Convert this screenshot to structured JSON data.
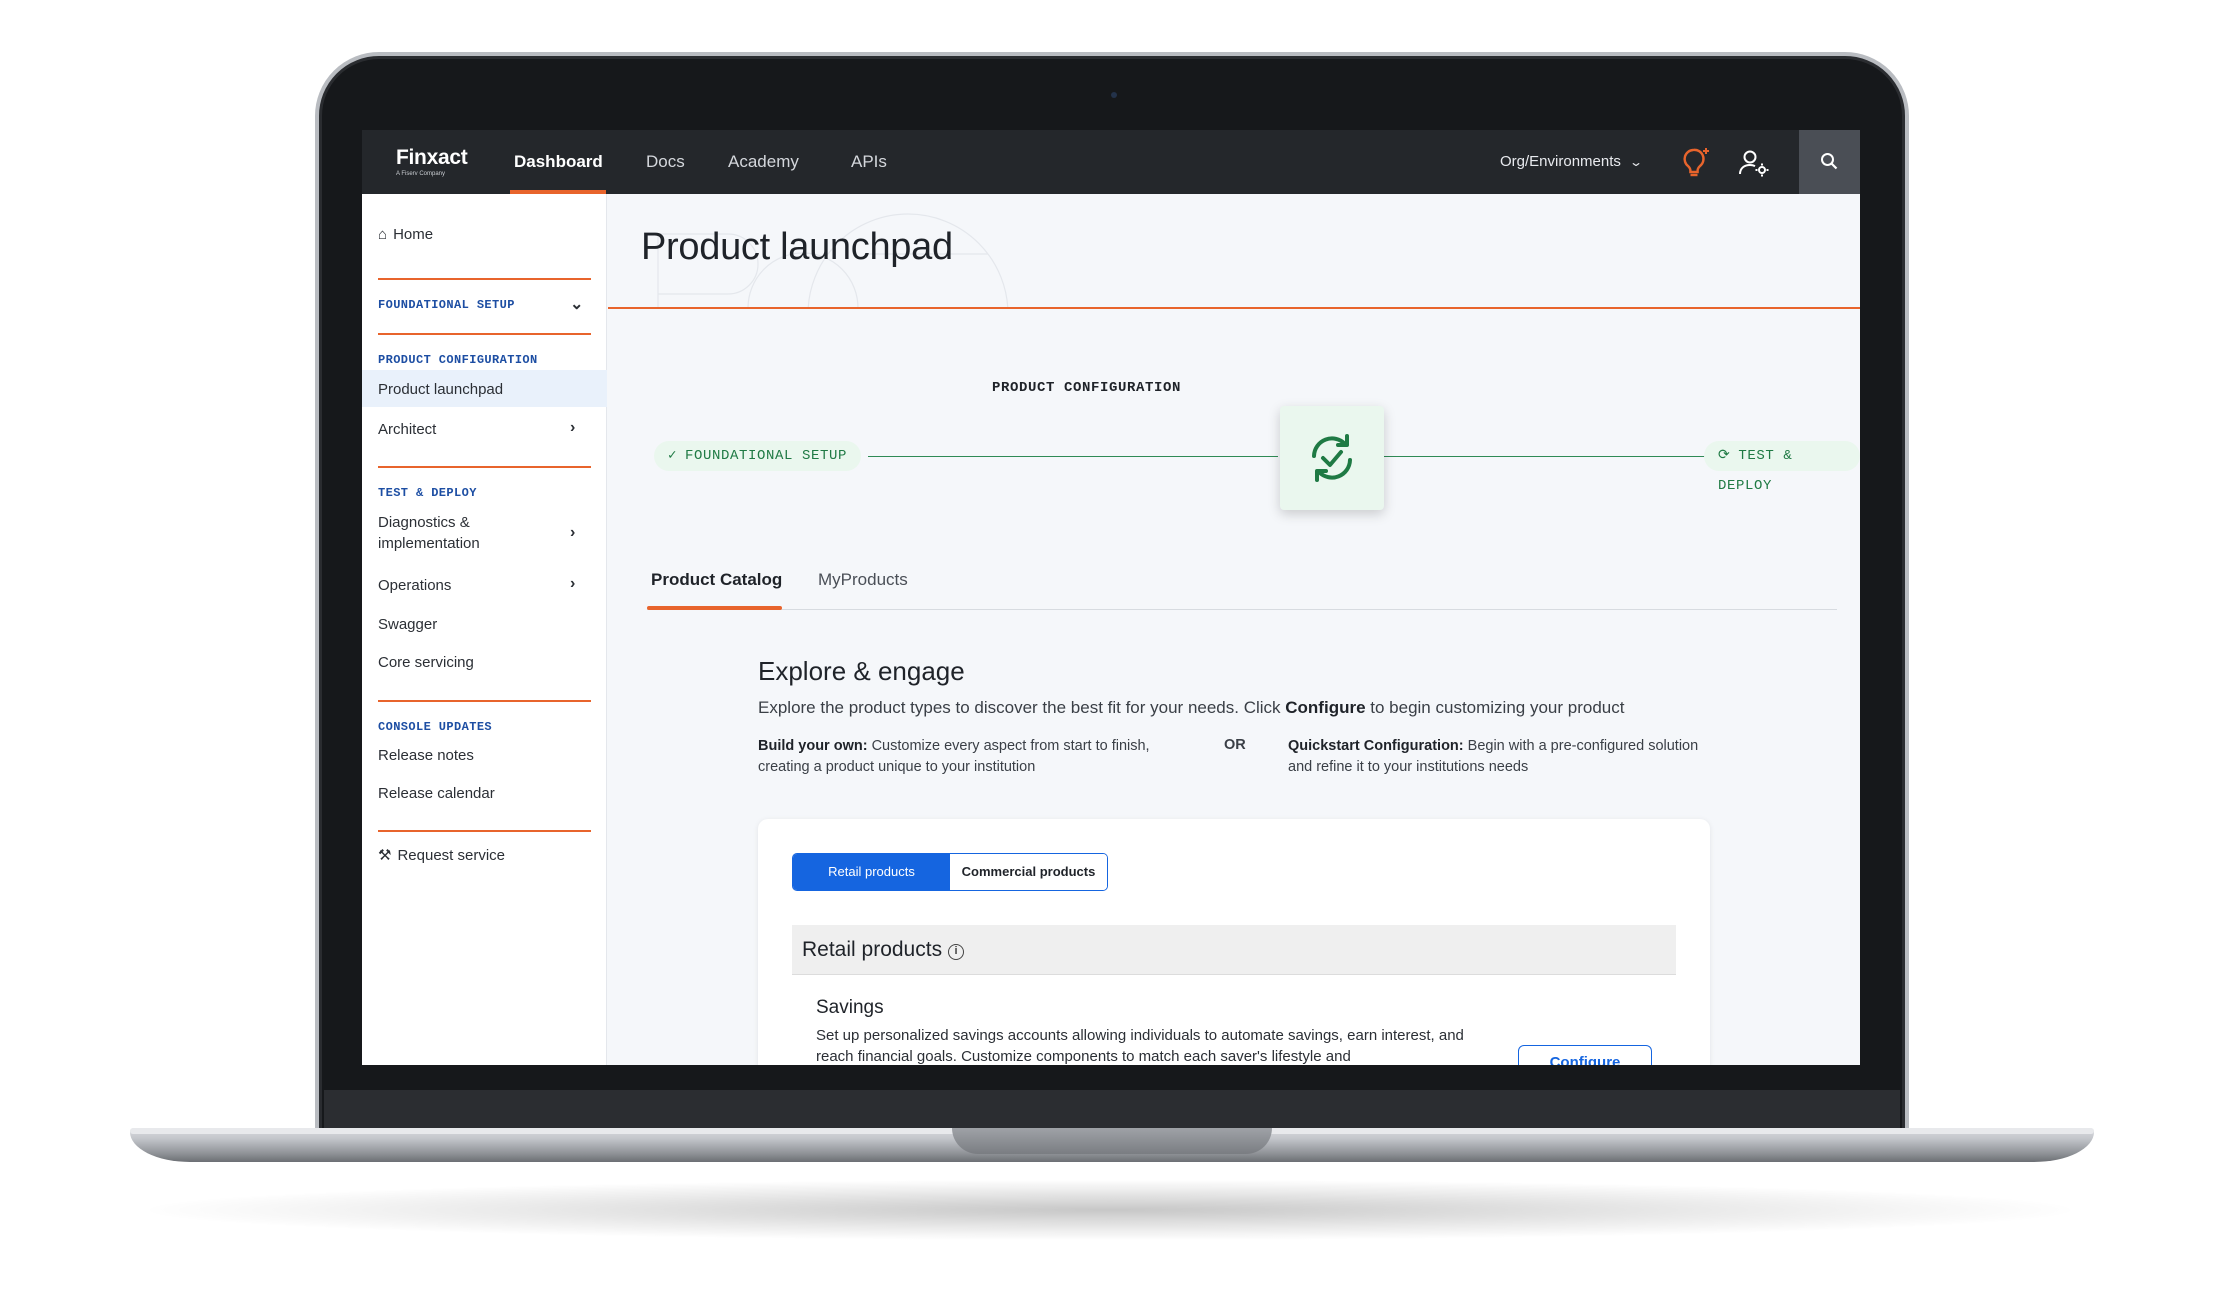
{
  "brand": {
    "name": "Finxact",
    "tagline": "A Fiserv Company"
  },
  "topnav": {
    "items": [
      {
        "label": "Dashboard",
        "active": true
      },
      {
        "label": "Docs"
      },
      {
        "label": "Academy"
      },
      {
        "label": "APIs"
      }
    ],
    "org_label": "Org/Environments",
    "icons": [
      "lightbulb-icon",
      "user-settings-icon",
      "search-icon"
    ]
  },
  "sidebar": {
    "home": "Home",
    "sections": [
      {
        "heading": "FOUNDATIONAL SETUP",
        "items": []
      },
      {
        "heading": "PRODUCT CONFIGURATION",
        "items": [
          "Product launchpad",
          "Architect"
        ]
      },
      {
        "heading": "TEST & DEPLOY",
        "items": [
          "Diagnostics &",
          "implementation",
          "Operations",
          "Swagger",
          "Core servicing"
        ]
      },
      {
        "heading": "CONSOLE UPDATES",
        "items": [
          "Release notes",
          "Release calendar"
        ]
      }
    ],
    "request_service": "Request service"
  },
  "main": {
    "title": "Product launchpad",
    "stepper": {
      "current": "PRODUCT CONFIGURATION",
      "previous": "FOUNDATIONAL SETUP",
      "next": "TEST & DEPLOY"
    },
    "tabs": [
      {
        "label": "Product Catalog",
        "active": true
      },
      {
        "label": "MyProducts"
      }
    ],
    "explore": {
      "title": "Explore & engage",
      "desc_pre": "Explore the product types to discover the best fit for your needs. Click ",
      "desc_bold": "Configure",
      "desc_post": " to begin customizing your product",
      "left_bold": "Build your own:",
      "left_text": " Customize every aspect from start to finish, creating a product unique to your institution",
      "or": "OR",
      "right_bold": "Quickstart Configuration:",
      "right_text": " Begin with a pre-configured solution and refine it to your institutions needs"
    },
    "card": {
      "segments": [
        {
          "label": "Retail products",
          "active": true
        },
        {
          "label": "Commercial products"
        }
      ],
      "section_title": "Retail products",
      "info_glyph": "i",
      "product": {
        "title": "Savings",
        "desc": "Set up personalized savings accounts allowing individuals to automate savings, earn interest, and reach financial goals. Customize components to match each saver's lifestyle and",
        "button": "Configure"
      }
    }
  },
  "colors": {
    "accent": "#e8642c",
    "link": "#1d4ea3",
    "primary": "#1565e0",
    "success": "#1f7a44",
    "nav_bg": "#24272b"
  }
}
